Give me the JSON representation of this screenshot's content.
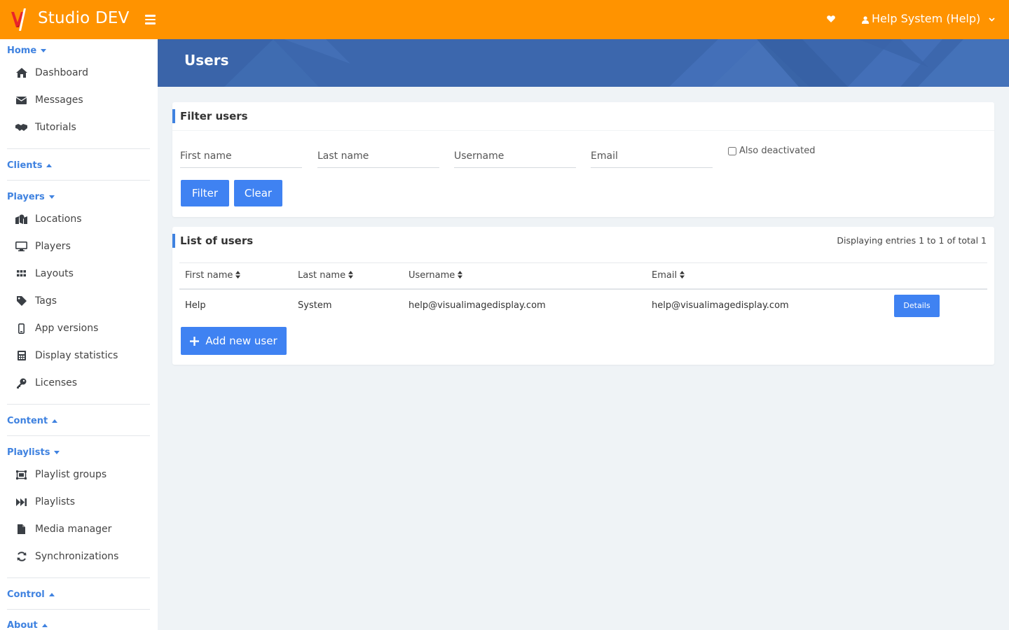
{
  "app": {
    "title": "Studio DEV"
  },
  "user_menu": {
    "label": "Help System (Help)"
  },
  "sidebar": {
    "sections": {
      "home": {
        "label": "Home"
      },
      "clients": {
        "label": "Clients"
      },
      "players": {
        "label": "Players"
      },
      "content": {
        "label": "Content"
      },
      "playlists": {
        "label": "Playlists"
      },
      "control": {
        "label": "Control"
      },
      "about": {
        "label": "About"
      }
    },
    "home_items": [
      {
        "label": "Dashboard",
        "icon": "home-icon"
      },
      {
        "label": "Messages",
        "icon": "envelope-icon"
      },
      {
        "label": "Tutorials",
        "icon": "handshake-icon"
      }
    ],
    "players_items": [
      {
        "label": "Locations",
        "icon": "map-marker-icon"
      },
      {
        "label": "Players",
        "icon": "desktop-icon"
      },
      {
        "label": "Layouts",
        "icon": "grid-icon"
      },
      {
        "label": "Tags",
        "icon": "tag-icon"
      },
      {
        "label": "App versions",
        "icon": "mobile-icon"
      },
      {
        "label": "Display statistics",
        "icon": "calculator-icon"
      },
      {
        "label": "Licenses",
        "icon": "key-icon"
      }
    ],
    "playlists_items": [
      {
        "label": "Playlist groups",
        "icon": "object-group-icon"
      },
      {
        "label": "Playlists",
        "icon": "fast-forward-icon"
      },
      {
        "label": "Media manager",
        "icon": "file-icon"
      },
      {
        "label": "Synchronizations",
        "icon": "sync-icon"
      }
    ]
  },
  "banner": {
    "title": "Users"
  },
  "filter": {
    "title": "Filter users",
    "first_name_placeholder": "First name",
    "last_name_placeholder": "Last name",
    "username_placeholder": "Username",
    "email_placeholder": "Email",
    "also_deactivated_label": "Also deactivated",
    "filter_label": "Filter",
    "clear_label": "Clear"
  },
  "list": {
    "title": "List of users",
    "entries_text": "Displaying entries 1 to 1 of total 1",
    "columns": [
      "First name",
      "Last name",
      "Username",
      "Email"
    ],
    "rows": [
      {
        "first_name": "Help",
        "last_name": "System",
        "username": "help@visualimagedisplay.com",
        "email": "help@visualimagedisplay.com",
        "action": "Details"
      }
    ],
    "add_label": "Add new user"
  },
  "colors": {
    "topbar": "#ff9300",
    "accent": "#3f82f2",
    "banner": "#3c67ad"
  }
}
